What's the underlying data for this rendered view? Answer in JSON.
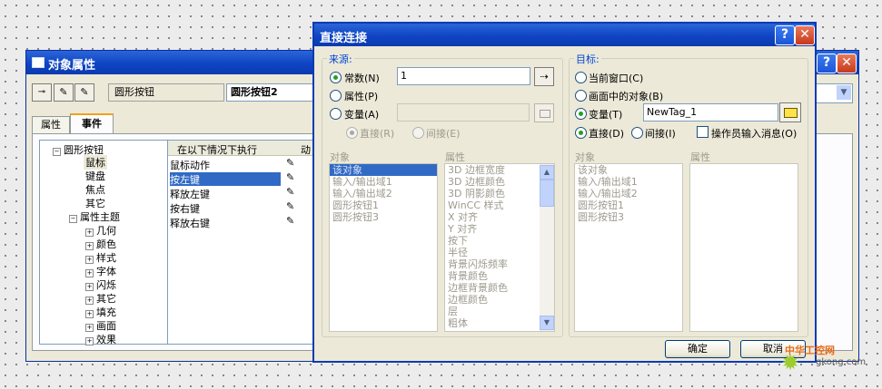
{
  "obj_props": {
    "title": "对象属性",
    "help_btn": "?",
    "close_btn": "✕",
    "object_name": "圆形按钮",
    "object_name_right": "圆形按钮2",
    "tabs": [
      "属性",
      "事件"
    ],
    "tree": {
      "root": "圆形按钮",
      "children": [
        "鼠标",
        "键盘",
        "焦点",
        "其它"
      ],
      "attr_theme": "属性主题",
      "theme_children": [
        "几何",
        "颜色",
        "样式",
        "字体",
        "闪烁",
        "其它",
        "填充",
        "画面",
        "效果"
      ]
    },
    "events_table": {
      "headers": [
        "在以下情况下执行",
        "动"
      ],
      "rows": [
        "鼠标动作",
        "按左键",
        "释放左键",
        "按右键",
        "释放右键"
      ],
      "selected_row": 1
    }
  },
  "direct_conn": {
    "title": "直接连接",
    "help_btn": "?",
    "close_btn": "✕",
    "source": {
      "label": "来源:",
      "constant": "常数(N)",
      "constant_value": "1",
      "property": "属性(P)",
      "variable": "变量(A)",
      "direct": "直接(R)",
      "indirect": "间接(E)",
      "object_header": "对象",
      "property_header": "属性",
      "objects": [
        "该对象",
        "输入/输出域1",
        "输入/输出域2",
        "圆形按钮1",
        "圆形按钮3"
      ],
      "properties": [
        "3D 边框宽度",
        "3D 边框颜色",
        "3D 阴影颜色",
        "WinCC 样式",
        "X 对齐",
        "Y 对齐",
        "按下",
        "半径",
        "背景闪烁频率",
        "背景颜色",
        "边框背景颜色",
        "边框颜色",
        "层",
        "粗体"
      ]
    },
    "target": {
      "label": "目标:",
      "current_window": "当前窗口(C)",
      "object_in_screen": "画面中的对象(B)",
      "variable": "变量(T)",
      "variable_value": "NewTag_1",
      "direct": "直接(D)",
      "indirect": "间接(I)",
      "operator_msg": "操作员输入消息(O)",
      "object_header": "对象",
      "property_header": "属性",
      "objects": [
        "该对象",
        "输入/输出域1",
        "输入/输出域2",
        "圆形按钮1",
        "圆形按钮3"
      ]
    },
    "ok_button": "确定",
    "cancel_button": "取消"
  },
  "watermark": {
    "text": "中华工控网",
    "url": "gkong.com"
  }
}
